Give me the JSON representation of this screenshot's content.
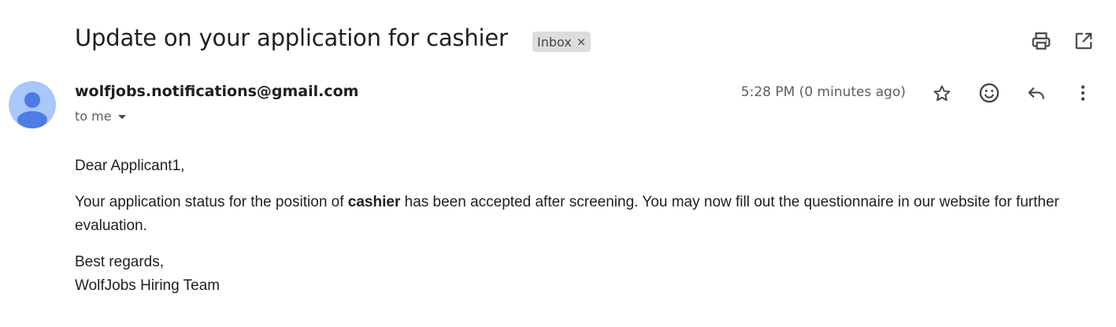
{
  "email": {
    "subject": "Update on your application for cashier",
    "label": "Inbox",
    "label_remove": "×",
    "sender": "wolfjobs.notifications@gmail.com",
    "recipient": "to me",
    "timestamp": "5:28 PM (0 minutes ago)",
    "body": {
      "greeting": "Dear Applicant1,",
      "status_pre": "Your application status for the position of ",
      "position": "cashier",
      "status_post": " has been accepted after screening. You may now fill out the questionnaire in our website for further evaluation.",
      "closing": "Best regards,",
      "signature": "WolfJobs Hiring Team"
    }
  },
  "icons": {
    "print": "print-icon",
    "open_new_window": "open-in-new-window-icon",
    "star": "star-icon",
    "emoji": "emoji-reaction-icon",
    "reply": "reply-icon",
    "more": "more-vert-icon",
    "avatar": "default-avatar-icon"
  },
  "colors": {
    "avatar_bg": "#a8c7fa",
    "avatar_fg": "#4d7ce6",
    "chip_bg": "#dddddd",
    "text": "#1f1f1f",
    "muted": "#5e5e5e"
  }
}
